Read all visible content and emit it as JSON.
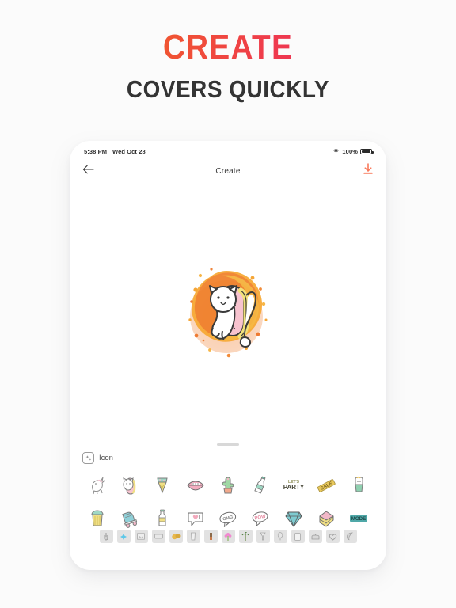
{
  "promo": {
    "title": "CREATE",
    "subtitle": "COVERS QUICKLY",
    "title_gradient_from": "#ef7622",
    "title_gradient_to": "#e8256d",
    "subtitle_color": "#343434"
  },
  "page_background": "#fbfbfb",
  "device": {
    "statusbar": {
      "time": "5:38 PM",
      "date": "Wed Oct 28",
      "battery_percent": "100%",
      "wifi_icon": "wifi-icon",
      "battery_icon": "battery-full-icon"
    },
    "navbar": {
      "back_icon": "arrow-left-icon",
      "title": "Create",
      "download_icon": "download-icon",
      "download_color": "#f97a5c"
    },
    "canvas": {
      "artwork_name": "cat-donut-watercolor-artwork",
      "splatter_color": "#f5a623",
      "splatter_color_2": "#ef6c2a",
      "splatter_tint": "#f8c39a",
      "donut_pink": "#f7c3cf",
      "donut_yellow": "#f2e17a",
      "cat_color": "#ffffff",
      "outline_color": "#3a3a3a"
    },
    "drawer": {
      "grabber": "drag-handle",
      "tab": {
        "icon": "sparkle-icon",
        "label": "Icon"
      },
      "stickers": [
        {
          "name": "unicorn-sticker",
          "label": "Unicorn"
        },
        {
          "name": "cat-donut-sticker",
          "label": "Cat Donut"
        },
        {
          "name": "ice-cream-sticker",
          "label": "Ice Cream Cone"
        },
        {
          "name": "lips-sticker",
          "label": "Lips"
        },
        {
          "name": "cactus-sticker",
          "label": "Cactus"
        },
        {
          "name": "bottle-sticker",
          "label": "Bottle"
        },
        {
          "name": "lets-party-sticker",
          "label": "LET'S PARTY"
        },
        {
          "name": "sale-banner-sticker",
          "label": "SALE"
        },
        {
          "name": "potted-plant-sticker",
          "label": "Potted Plant"
        },
        {
          "name": "beer-mug-sticker",
          "label": "Beer Mug"
        },
        {
          "name": "roller-skate-sticker",
          "label": "Roller Skate"
        },
        {
          "name": "soda-bottle-sticker",
          "label": "Soda Bottle"
        },
        {
          "name": "heart-bubble-sticker",
          "label": "Heart Speech Bubble"
        },
        {
          "name": "speech-bubble-sticker",
          "label": "Speech Bubble"
        },
        {
          "name": "pow-bubble-sticker",
          "label": "POW Bubble"
        },
        {
          "name": "diamond-sticker",
          "label": "Diamond"
        },
        {
          "name": "cake-slice-sticker",
          "label": "Cake Slice"
        },
        {
          "name": "word-tag-sticker",
          "label": "Word Tag"
        }
      ],
      "categories": [
        {
          "name": "category-hand-icon",
          "glyph": "☝"
        },
        {
          "name": "category-splash-icon",
          "glyph": "❄"
        },
        {
          "name": "category-photo-icon",
          "glyph": "❑"
        },
        {
          "name": "category-banner-icon",
          "glyph": "▭"
        },
        {
          "name": "category-food-icon",
          "glyph": "◕"
        },
        {
          "name": "category-cup-icon",
          "glyph": "▮"
        },
        {
          "name": "category-brush-icon",
          "glyph": "✒"
        },
        {
          "name": "category-flower-icon",
          "glyph": "❁"
        },
        {
          "name": "category-palm-icon",
          "glyph": "☙"
        },
        {
          "name": "category-drink-icon",
          "glyph": "¥"
        },
        {
          "name": "category-balloon-icon",
          "glyph": "♀"
        },
        {
          "name": "category-card-icon",
          "glyph": "▯"
        },
        {
          "name": "category-cake-icon",
          "glyph": "♛"
        },
        {
          "name": "category-heart-icon",
          "glyph": "♡"
        },
        {
          "name": "category-leaf-icon",
          "glyph": "❦"
        }
      ]
    }
  }
}
